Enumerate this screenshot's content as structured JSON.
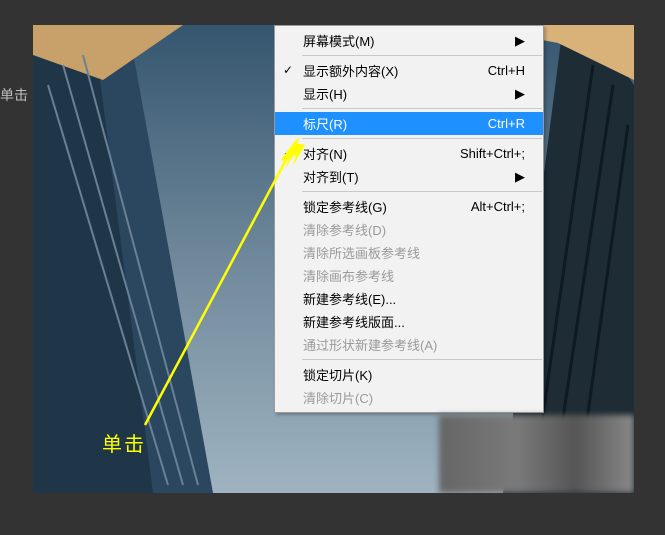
{
  "outside_label": "单击",
  "annotation": "单击",
  "menu": {
    "screen_mode": {
      "label": "屏幕模式(M)",
      "submenu": true
    },
    "show_extras": {
      "label": "显示额外内容(X)",
      "shortcut": "Ctrl+H",
      "checked": true
    },
    "show": {
      "label": "显示(H)",
      "submenu": true
    },
    "rulers": {
      "label": "标尺(R)",
      "shortcut": "Ctrl+R",
      "highlight": true
    },
    "snap": {
      "label": "对齐(N)",
      "shortcut": "Shift+Ctrl+;",
      "checked": true
    },
    "snap_to": {
      "label": "对齐到(T)",
      "submenu": true
    },
    "lock_guides": {
      "label": "锁定参考线(G)",
      "shortcut": "Alt+Ctrl+;"
    },
    "clear_guides": {
      "label": "清除参考线(D)",
      "disabled": true
    },
    "clear_artboard_guides": {
      "label": "清除所选画板参考线",
      "disabled": true
    },
    "clear_canvas_guides": {
      "label": "清除画布参考线",
      "disabled": true
    },
    "new_guide": {
      "label": "新建参考线(E)..."
    },
    "new_guide_layout": {
      "label": "新建参考线版面..."
    },
    "new_guide_from_shape": {
      "label": "通过形状新建参考线(A)",
      "disabled": true
    },
    "lock_slices": {
      "label": "锁定切片(K)"
    },
    "clear_slices": {
      "label": "清除切片(C)",
      "disabled": true
    }
  }
}
